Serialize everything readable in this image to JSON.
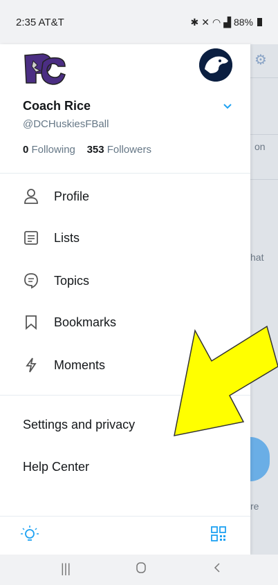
{
  "status_bar": {
    "time_carrier": "2:35 AT&T",
    "battery": "88%"
  },
  "profile": {
    "name": "Coach Rice",
    "handle": "@DCHuskiesFBall",
    "following_count": "0",
    "following_label": "Following",
    "followers_count": "353",
    "followers_label": "Followers"
  },
  "menu": {
    "items": [
      {
        "label": "Profile",
        "icon": "person-icon"
      },
      {
        "label": "Lists",
        "icon": "list-icon"
      },
      {
        "label": "Topics",
        "icon": "topics-icon"
      },
      {
        "label": "Bookmarks",
        "icon": "bookmark-icon"
      },
      {
        "label": "Moments",
        "icon": "lightning-icon"
      }
    ],
    "settings": "Settings and privacy",
    "help": "Help Center"
  },
  "behind": {
    "text_on": "on",
    "text_hat": "hat",
    "text_re": "re"
  },
  "colors": {
    "accent": "#1da1f2",
    "arrow_fill": "#ffff00"
  }
}
